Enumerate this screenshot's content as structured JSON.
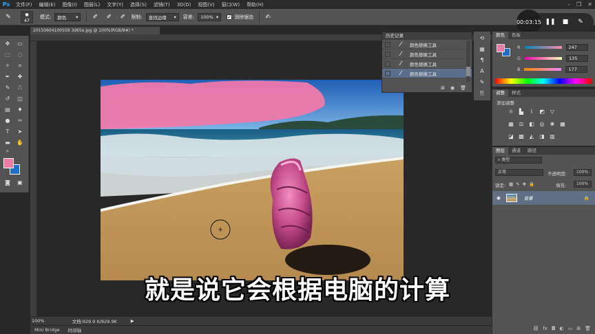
{
  "menu": {
    "logo": "Ps",
    "items": [
      "文件(F)",
      "编辑(E)",
      "图像(I)",
      "图层(L)",
      "文字(Y)",
      "选择(S)",
      "滤镜(T)",
      "3D(D)",
      "视图(V)",
      "窗口(W)",
      "帮助(H)"
    ]
  },
  "options": {
    "brush_size": "47",
    "mode_label": "模式:",
    "mode_value": "颜色",
    "limits_label": "限制:",
    "limits_value": "查找边缘",
    "tolerance_label": "容差:",
    "tolerance_value": "100%",
    "antialias_label": "消除锯齿"
  },
  "recorder": {
    "time": "00:03:15"
  },
  "document": {
    "tab_title": "20150604100558 3d65e.jpg @ 100%(RGB/8#) *",
    "zoom": "100%",
    "doc_info": "文档:929.9 K/929.9K"
  },
  "subtitle": "就是说它会根据电脑的计算",
  "bottom_tabs": [
    "Mini Bridge",
    "时间轴"
  ],
  "history": {
    "title": "历史记录",
    "items": [
      "颜色替换工具",
      "颜色替换工具",
      "颜色替换工具",
      "颜色替换工具"
    ]
  },
  "color_panel": {
    "tabs": [
      "颜色",
      "色板"
    ],
    "channels": [
      {
        "label": "R",
        "value": "247"
      },
      {
        "label": "G",
        "value": "135"
      },
      {
        "label": "B",
        "value": "177"
      }
    ]
  },
  "adjust_panel": {
    "tabs": [
      "调整",
      "样式"
    ],
    "title": "添加调整"
  },
  "layers_panel": {
    "tabs": [
      "图层",
      "通道",
      "路径"
    ],
    "kind": "类型",
    "blend": "正常",
    "opacity_label": "不透明度:",
    "opacity_value": "100%",
    "lock_label": "锁定:",
    "fill_label": "填充:",
    "fill_value": "100%",
    "layer_name": "背景"
  },
  "colors": {
    "foreground": "#ed7ba6",
    "background": "#1f6fd1",
    "selected_row": "#5b6e8c"
  }
}
